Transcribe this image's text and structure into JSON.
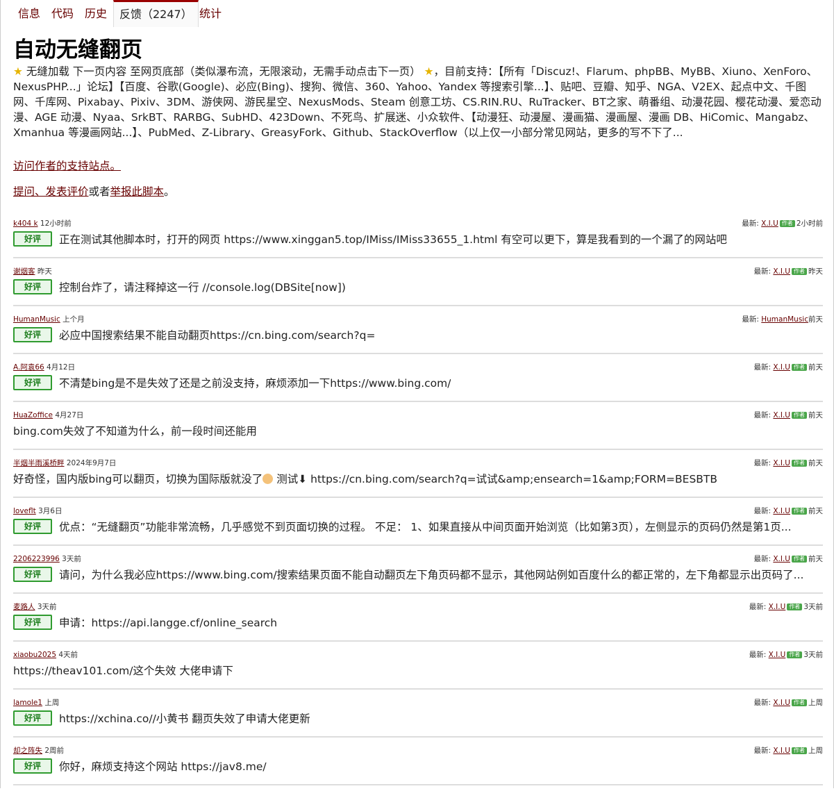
{
  "tabs": [
    {
      "label": "信息"
    },
    {
      "label": "代码"
    },
    {
      "label": "历史"
    },
    {
      "label": "反馈（2247）"
    },
    {
      "label": "统计"
    }
  ],
  "title": "自动无缝翻页",
  "description": "无缝加载 下一页内容 至网页底部（类似瀑布流，无限滚动，无需手动点击下一页）",
  "description_tail": "，目前支持：【所有「Discuz!、Flarum、phpBB、MyBB、Xiuno、XenForo、NexusPHP...」论坛】【百度、谷歌(Google)、必应(Bing)、搜狗、微信、360、Yahoo、Yandex 等搜索引擎...】、贴吧、豆瓣、知乎、NGA、V2EX、起点中文、千图网、千库网、Pixabay、Pixiv、3DM、游侠网、游民星空、NexusMods、Steam 创意工坊、CS.RIN.RU、RuTracker、BT之家、萌番组、动漫花园、樱花动漫、爱恋动漫、AGE 动漫、Nyaa、SrkBT、RARBG、SubHD、423Down、不死鸟、扩展迷、小众软件、【动漫狂、动漫屋、漫画猫、漫画屋、漫画 DB、HiComic、Mangabz、Xmanhua 等漫画网站...】、PubMed、Z-Library、GreasyFork、Github、StackOverflow（以上仅一小部分常见网站，更多的写不下了...",
  "support_link": "访问作者的支持站点。",
  "ask": {
    "link1": "提问、发表评价",
    "mid": "或者",
    "link2": "举报此脚本",
    "end": "。"
  },
  "latest_label": "最新:",
  "author_badge": "作者",
  "rating_label": "好评",
  "comments": [
    {
      "user": "k404 k",
      "time": "12小时前",
      "latest_user": "X.I.U",
      "author": true,
      "latest_time": "2小时前",
      "rated": true,
      "text": "正在测试其他脚本时，打开的网页 https://www.xinggan5.top/IMiss/IMiss33655_1.html 有空可以更下，算是我看到的一个漏了的网站吧"
    },
    {
      "user": "谢烟客",
      "time": "昨天",
      "latest_user": "X.I.U",
      "author": true,
      "latest_time": "昨天",
      "rated": true,
      "text": "控制台炸了，请注释掉这一行 //console.log(DBSite[now])"
    },
    {
      "user": "HumanMusic",
      "time": "上个月",
      "latest_user": "HumanMusic",
      "author": false,
      "latest_time": "前天",
      "rated": true,
      "text": "必应中国搜索结果不能自动翻页https://cn.bing.com/search?q="
    },
    {
      "user": "A.阿袁66",
      "time": "4月12日",
      "latest_user": "X.I.U",
      "author": true,
      "latest_time": "前天",
      "rated": true,
      "text": "不清楚bing是不是失效了还是之前没支持，麻烦添加一下https://www.bing.com/"
    },
    {
      "user": "HuaZoffice",
      "time": "4月27日",
      "latest_user": "X.I.U",
      "author": true,
      "latest_time": "前天",
      "rated": false,
      "text": "bing.com失效了不知道为什么，前一段时间还能用"
    },
    {
      "user": "半烟半雨溪桥畔",
      "time": "2024年9月7日",
      "latest_user": "X.I.U",
      "author": true,
      "latest_time": "前天",
      "rated": false,
      "text": "好奇怪，国内版bing可以翻页，切换为国际版就没了",
      "emoji": true,
      "text2": " 测试⬇ https://cn.bing.com/search?q=试试&amp;ensearch=1&amp;FORM=BESBTB"
    },
    {
      "user": "loveflt",
      "time": "3月6日",
      "latest_user": "X.I.U",
      "author": true,
      "latest_time": "前天",
      "rated": true,
      "text": "优点：“无缝翻页”功能非常流畅，几乎感觉不到页面切换的过程。 不足： 1、如果直接从中间页面开始浏览（比如第3页），左侧显示的页码仍然是第1页..."
    },
    {
      "user": "2206223996",
      "time": "3天前",
      "latest_user": "X.I.U",
      "author": true,
      "latest_time": "前天",
      "rated": true,
      "text": "请问，为什么我必应https://www.bing.com/搜索结果页面不能自动翻页左下角页码都不显示，其他网站例如百度什么的都正常的，左下角都显示出页码了..."
    },
    {
      "user": "麦路人",
      "time": "3天前",
      "latest_user": "X.I.U",
      "author": true,
      "latest_time": "3天前",
      "rated": true,
      "text": "申请：https://api.langge.cf/online_search"
    },
    {
      "user": "xiaobu2025",
      "time": "4天前",
      "latest_user": "X.I.U",
      "author": true,
      "latest_time": "3天前",
      "rated": false,
      "text": "https://theav101.com/这个失效 大佬申请下"
    },
    {
      "user": "lamole1",
      "time": "上周",
      "latest_user": "X.I.U",
      "author": true,
      "latest_time": "上周",
      "rated": true,
      "text": "https://xchina.co//小黄书 翻页失效了申请大佬更新"
    },
    {
      "user": "却之阵失",
      "time": "2周前",
      "latest_user": "X.I.U",
      "author": true,
      "latest_time": "上周",
      "rated": true,
      "text": "你好，麻烦支持这个网站 https://jav8.me/"
    }
  ]
}
